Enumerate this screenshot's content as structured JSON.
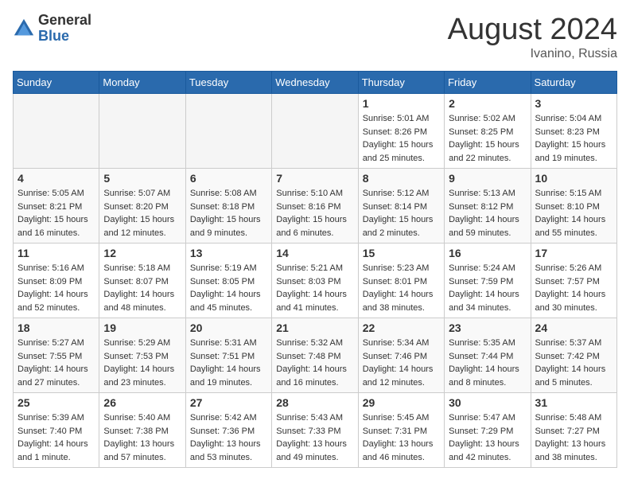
{
  "header": {
    "logo": {
      "general": "General",
      "blue": "Blue"
    },
    "month": "August 2024",
    "location": "Ivanino, Russia"
  },
  "weekdays": [
    "Sunday",
    "Monday",
    "Tuesday",
    "Wednesday",
    "Thursday",
    "Friday",
    "Saturday"
  ],
  "weeks": [
    [
      {
        "day": "",
        "info": ""
      },
      {
        "day": "",
        "info": ""
      },
      {
        "day": "",
        "info": ""
      },
      {
        "day": "",
        "info": ""
      },
      {
        "day": "1",
        "info": "Sunrise: 5:01 AM\nSunset: 8:26 PM\nDaylight: 15 hours\nand 25 minutes."
      },
      {
        "day": "2",
        "info": "Sunrise: 5:02 AM\nSunset: 8:25 PM\nDaylight: 15 hours\nand 22 minutes."
      },
      {
        "day": "3",
        "info": "Sunrise: 5:04 AM\nSunset: 8:23 PM\nDaylight: 15 hours\nand 19 minutes."
      }
    ],
    [
      {
        "day": "4",
        "info": "Sunrise: 5:05 AM\nSunset: 8:21 PM\nDaylight: 15 hours\nand 16 minutes."
      },
      {
        "day": "5",
        "info": "Sunrise: 5:07 AM\nSunset: 8:20 PM\nDaylight: 15 hours\nand 12 minutes."
      },
      {
        "day": "6",
        "info": "Sunrise: 5:08 AM\nSunset: 8:18 PM\nDaylight: 15 hours\nand 9 minutes."
      },
      {
        "day": "7",
        "info": "Sunrise: 5:10 AM\nSunset: 8:16 PM\nDaylight: 15 hours\nand 6 minutes."
      },
      {
        "day": "8",
        "info": "Sunrise: 5:12 AM\nSunset: 8:14 PM\nDaylight: 15 hours\nand 2 minutes."
      },
      {
        "day": "9",
        "info": "Sunrise: 5:13 AM\nSunset: 8:12 PM\nDaylight: 14 hours\nand 59 minutes."
      },
      {
        "day": "10",
        "info": "Sunrise: 5:15 AM\nSunset: 8:10 PM\nDaylight: 14 hours\nand 55 minutes."
      }
    ],
    [
      {
        "day": "11",
        "info": "Sunrise: 5:16 AM\nSunset: 8:09 PM\nDaylight: 14 hours\nand 52 minutes."
      },
      {
        "day": "12",
        "info": "Sunrise: 5:18 AM\nSunset: 8:07 PM\nDaylight: 14 hours\nand 48 minutes."
      },
      {
        "day": "13",
        "info": "Sunrise: 5:19 AM\nSunset: 8:05 PM\nDaylight: 14 hours\nand 45 minutes."
      },
      {
        "day": "14",
        "info": "Sunrise: 5:21 AM\nSunset: 8:03 PM\nDaylight: 14 hours\nand 41 minutes."
      },
      {
        "day": "15",
        "info": "Sunrise: 5:23 AM\nSunset: 8:01 PM\nDaylight: 14 hours\nand 38 minutes."
      },
      {
        "day": "16",
        "info": "Sunrise: 5:24 AM\nSunset: 7:59 PM\nDaylight: 14 hours\nand 34 minutes."
      },
      {
        "day": "17",
        "info": "Sunrise: 5:26 AM\nSunset: 7:57 PM\nDaylight: 14 hours\nand 30 minutes."
      }
    ],
    [
      {
        "day": "18",
        "info": "Sunrise: 5:27 AM\nSunset: 7:55 PM\nDaylight: 14 hours\nand 27 minutes."
      },
      {
        "day": "19",
        "info": "Sunrise: 5:29 AM\nSunset: 7:53 PM\nDaylight: 14 hours\nand 23 minutes."
      },
      {
        "day": "20",
        "info": "Sunrise: 5:31 AM\nSunset: 7:51 PM\nDaylight: 14 hours\nand 19 minutes."
      },
      {
        "day": "21",
        "info": "Sunrise: 5:32 AM\nSunset: 7:48 PM\nDaylight: 14 hours\nand 16 minutes."
      },
      {
        "day": "22",
        "info": "Sunrise: 5:34 AM\nSunset: 7:46 PM\nDaylight: 14 hours\nand 12 minutes."
      },
      {
        "day": "23",
        "info": "Sunrise: 5:35 AM\nSunset: 7:44 PM\nDaylight: 14 hours\nand 8 minutes."
      },
      {
        "day": "24",
        "info": "Sunrise: 5:37 AM\nSunset: 7:42 PM\nDaylight: 14 hours\nand 5 minutes."
      }
    ],
    [
      {
        "day": "25",
        "info": "Sunrise: 5:39 AM\nSunset: 7:40 PM\nDaylight: 14 hours\nand 1 minute."
      },
      {
        "day": "26",
        "info": "Sunrise: 5:40 AM\nSunset: 7:38 PM\nDaylight: 13 hours\nand 57 minutes."
      },
      {
        "day": "27",
        "info": "Sunrise: 5:42 AM\nSunset: 7:36 PM\nDaylight: 13 hours\nand 53 minutes."
      },
      {
        "day": "28",
        "info": "Sunrise: 5:43 AM\nSunset: 7:33 PM\nDaylight: 13 hours\nand 49 minutes."
      },
      {
        "day": "29",
        "info": "Sunrise: 5:45 AM\nSunset: 7:31 PM\nDaylight: 13 hours\nand 46 minutes."
      },
      {
        "day": "30",
        "info": "Sunrise: 5:47 AM\nSunset: 7:29 PM\nDaylight: 13 hours\nand 42 minutes."
      },
      {
        "day": "31",
        "info": "Sunrise: 5:48 AM\nSunset: 7:27 PM\nDaylight: 13 hours\nand 38 minutes."
      }
    ]
  ]
}
